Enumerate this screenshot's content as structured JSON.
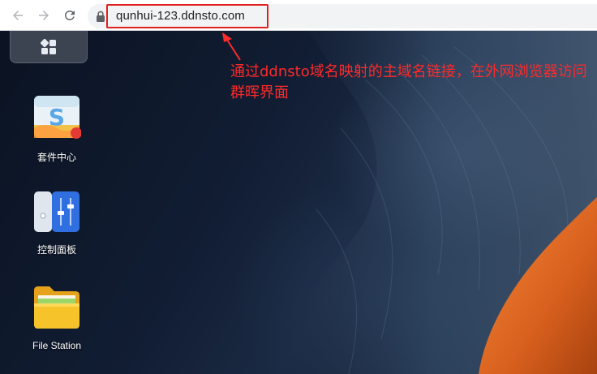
{
  "browser": {
    "back_icon": "arrow-left-icon",
    "forward_icon": "arrow-right-icon",
    "reload_icon": "reload-icon",
    "lock_icon": "lock-icon",
    "url": "qunhui-123.ddnsto.com"
  },
  "desktop": {
    "start_icon": "grid-icon",
    "apps": [
      {
        "label": "套件中心",
        "icon": "package-center-icon",
        "badge_color": "#e53935"
      },
      {
        "label": "控制面板",
        "icon": "control-panel-icon"
      },
      {
        "label": "File Station",
        "icon": "folder-icon"
      }
    ]
  },
  "annotation": {
    "text": "通过ddnsto域名映射的主域名链接，在外网浏览器访问群晖界面",
    "color": "#ff2a2a"
  }
}
